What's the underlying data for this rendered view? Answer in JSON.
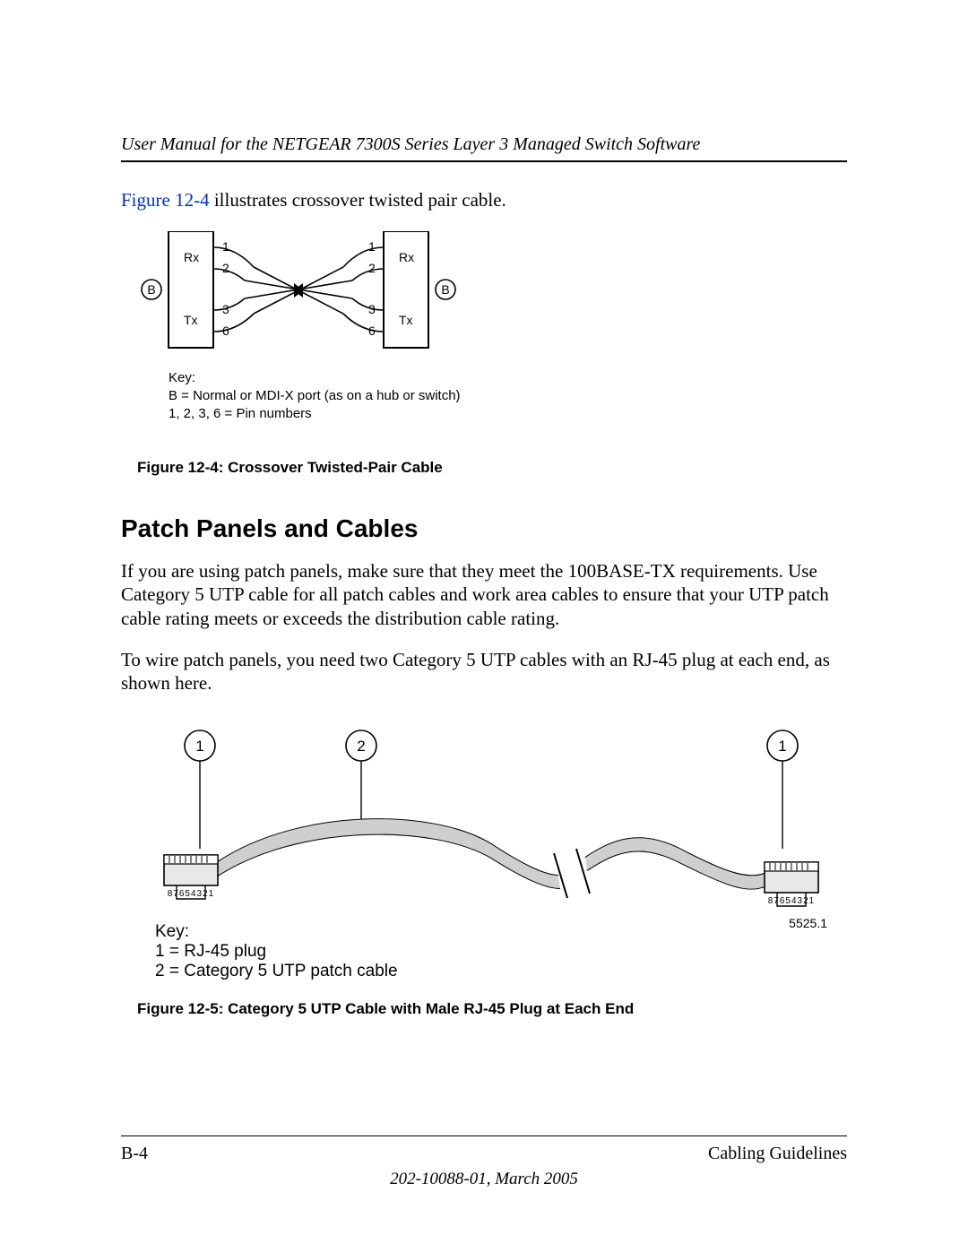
{
  "header": {
    "title": "User Manual for the NETGEAR 7300S Series Layer 3 Managed Switch Software"
  },
  "intro": {
    "ref": "Figure 12-4",
    "rest": " illustrates crossover twisted pair cable."
  },
  "fig1": {
    "caption": "Figure 12-4:  Crossover Twisted-Pair Cable",
    "left_rx": "Rx",
    "left_tx": "Tx",
    "right_rx": "Rx",
    "right_tx": "Tx",
    "badge": "B",
    "pins": {
      "p1": "1",
      "p2": "2",
      "p3": "3",
      "p6": "6"
    },
    "key_title": "Key:",
    "key_line1": "B = Normal or MDI-X port (as on a hub or switch)",
    "key_line2": "1, 2, 3, 6 = Pin numbers"
  },
  "section": {
    "heading": "Patch Panels and Cables",
    "para1": "If you are using patch panels, make sure that they meet the 100BASE-TX requirements. Use Category 5 UTP cable for all patch cables and work area cables to ensure that your UTP patch cable rating meets or exceeds the distribution cable rating.",
    "para2": "To wire patch panels, you need two Category 5 UTP cables with an RJ-45 plug at each end, as shown here."
  },
  "fig2": {
    "caption": "Figure 12-5:  Category 5 UTP Cable with Male RJ-45 Plug at Each End",
    "call1": "1",
    "call2": "2",
    "key_title": "Key:",
    "key_line1": "1 = RJ-45 plug",
    "key_line2": "2 = Category 5 UTP patch cable",
    "plug_nums": "87654321",
    "artnum": "5525.1"
  },
  "footer": {
    "page": "B-4",
    "section": "Cabling Guidelines",
    "docid": "202-10088-01, March 2005"
  }
}
